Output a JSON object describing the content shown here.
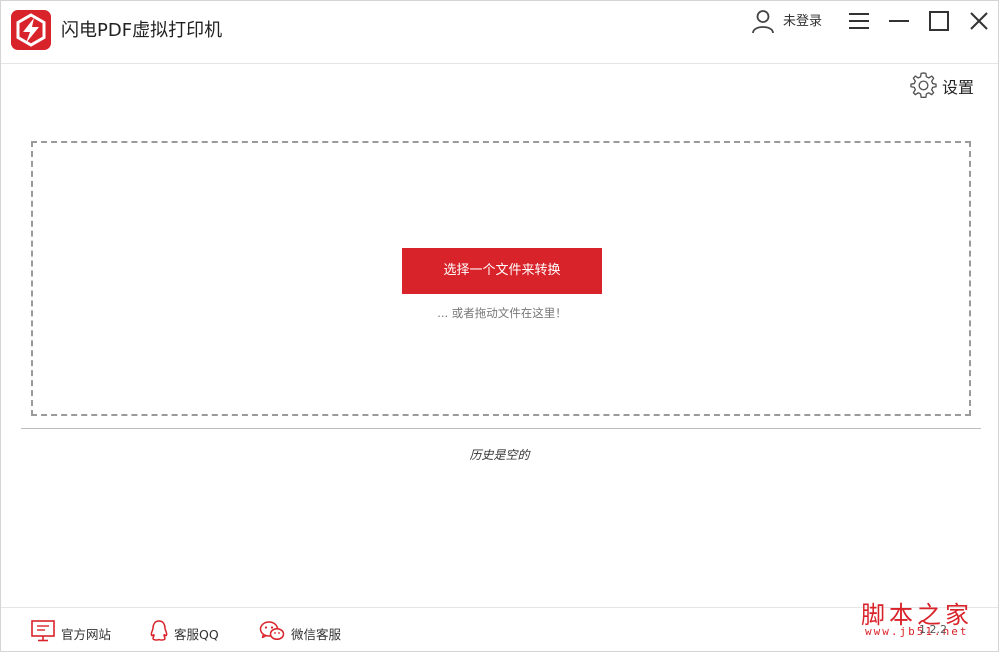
{
  "app": {
    "title": "闪电PDF虚拟打印机",
    "logo_icon": "lightning-logo-icon",
    "accent_color": "#d9232a"
  },
  "titlebar": {
    "user_label": "未登录",
    "user_icon": "user-icon",
    "menu_icon": "hamburger-menu-icon",
    "minimize_icon": "minimize-icon",
    "maximize_icon": "maximize-icon",
    "close_icon": "close-icon"
  },
  "settings": {
    "label": "设置",
    "icon": "gear-icon"
  },
  "dropzone": {
    "select_button_label": "选择一个文件来转换",
    "drag_hint": "... 或者拖动文件在这里！"
  },
  "history": {
    "empty_text": "历史是空的"
  },
  "footer": {
    "links": [
      {
        "label": "官方网站",
        "icon": "monitor-icon"
      },
      {
        "label": "客服QQ",
        "icon": "qq-icon"
      },
      {
        "label": "微信客服",
        "icon": "wechat-icon"
      }
    ],
    "version": "1.2.2"
  },
  "watermark": {
    "text": "脚本之家",
    "url": "www.jb51.net"
  }
}
